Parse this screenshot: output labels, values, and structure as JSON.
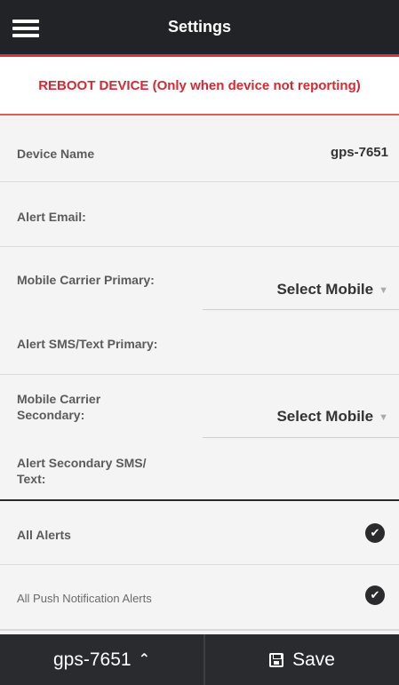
{
  "header": {
    "title": "Settings",
    "menu_icon": "hamburger-menu-icon"
  },
  "reboot": {
    "label": "REBOOT DEVICE (Only when device not reporting)"
  },
  "device_name": {
    "label": "Device Name",
    "value": "gps-7651"
  },
  "alert_email": {
    "label": "Alert Email:",
    "value": ""
  },
  "carrier_primary": {
    "label": "Mobile Carrier Primary:",
    "selected": "Select Mobile"
  },
  "sms_primary": {
    "label": "Alert SMS/Text Primary:",
    "value": ""
  },
  "carrier_secondary": {
    "label_line1": "Mobile Carrier",
    "label_line2": "Secondary:",
    "selected": "Select Mobile"
  },
  "sms_secondary": {
    "label_line1": "Alert Secondary SMS/",
    "label_line2": "Text:",
    "value": ""
  },
  "all_alerts": {
    "label": "All Alerts",
    "checked": true
  },
  "push_alerts": {
    "label": "All Push Notification Alerts",
    "checked": true
  },
  "footer": {
    "device_label": "gps-7651",
    "save_label": "Save"
  }
}
